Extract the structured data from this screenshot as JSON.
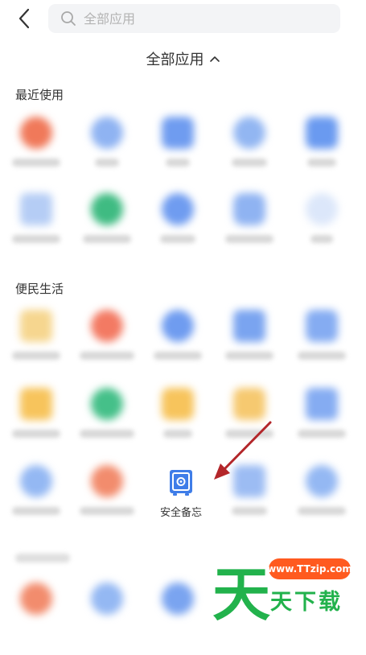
{
  "search": {
    "placeholder": "全部应用"
  },
  "header": {
    "title": "全部应用"
  },
  "sections": [
    {
      "title": "最近使用"
    },
    {
      "title": "便民生活"
    }
  ],
  "highlighted_app": {
    "label": "安全备忘"
  },
  "watermark": {
    "url": "www.TTzip.com",
    "big_char": "天",
    "small_text": "天下载"
  },
  "colors": {
    "accent_blue": "#3f7de8",
    "arrow_red": "#b3262a",
    "watermark_green": "#22b24c",
    "watermark_orange": "#ff5a1f"
  }
}
